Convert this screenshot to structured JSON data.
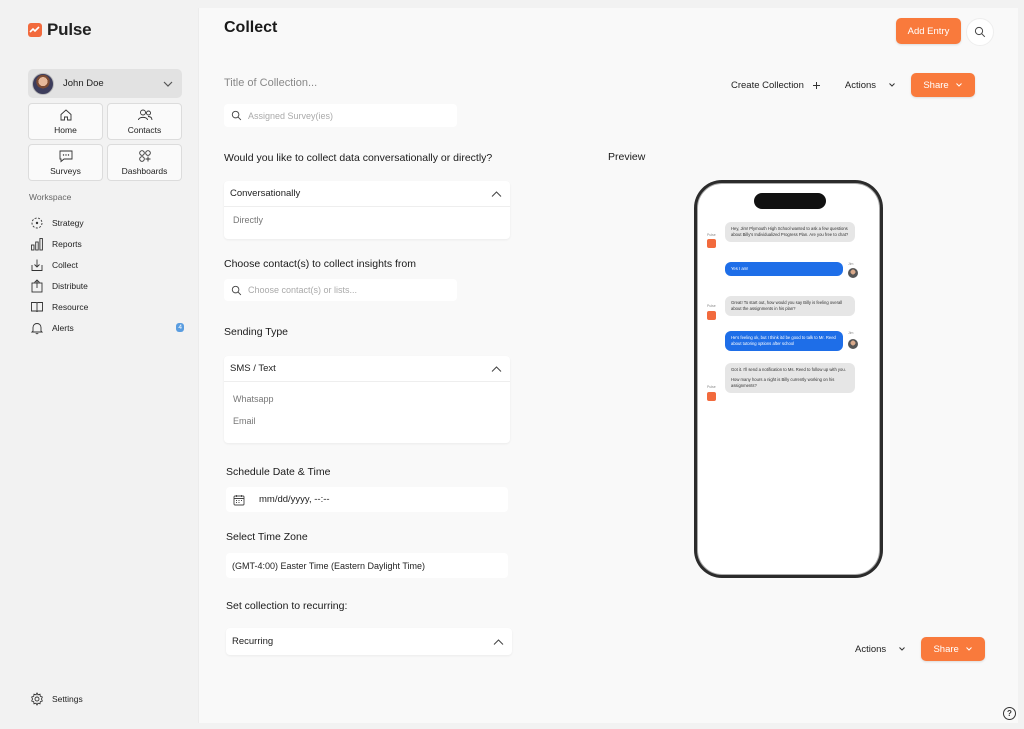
{
  "app": {
    "name": "Pulse",
    "brand_color": "#f26a3d"
  },
  "user": {
    "name": "John Doe"
  },
  "nav_tiles": [
    {
      "label": "Home",
      "icon": "home-icon"
    },
    {
      "label": "Contacts",
      "icon": "contacts-icon"
    },
    {
      "label": "Surveys",
      "icon": "chat-icon"
    },
    {
      "label": "Dashboards",
      "icon": "dashboard-icon"
    }
  ],
  "workspace": {
    "label": "Workspace",
    "items": [
      {
        "label": "Strategy",
        "icon": "strategy-icon"
      },
      {
        "label": "Reports",
        "icon": "reports-icon"
      },
      {
        "label": "Collect",
        "icon": "collect-icon"
      },
      {
        "label": "Distribute",
        "icon": "distribute-icon"
      },
      {
        "label": "Resource",
        "icon": "book-icon"
      },
      {
        "label": "Alerts",
        "icon": "bell-icon",
        "badge": "4"
      }
    ]
  },
  "settings_label": "Settings",
  "header": {
    "title": "Collect",
    "add_entry": "Add Entry"
  },
  "form": {
    "title_placeholder": "Title of Collection...",
    "survey_placeholder": "Assigned Survey(ies)",
    "collect_question": "Would you like to collect data conversationally or directly?",
    "collect_selected": "Conversationally",
    "collect_options": [
      "Directly"
    ],
    "contacts_question": "Choose contact(s) to collect insights from",
    "contacts_placeholder": "Choose contact(s) or lists...",
    "sending_label": "Sending Type",
    "sending_selected": "SMS / Text",
    "sending_options": [
      "Whatsapp",
      "Email"
    ],
    "schedule_label": "Schedule Date & Time",
    "schedule_value": "mm/dd/yyyy, --:--",
    "timezone_label": "Select Time Zone",
    "timezone_value": "(GMT-4:00) Easter Time (Eastern Daylight Time)",
    "recurring_label": "Set collection to recurring:",
    "recurring_selected": "Recurring"
  },
  "toolbar": {
    "create_collection": "Create Collection",
    "actions": "Actions",
    "share": "Share"
  },
  "preview": {
    "label": "Preview",
    "messages": [
      {
        "from": "bot",
        "sender": "Pulse",
        "text": "Hey, Jim! Plymouth High School wanted to ask a few questions about Billy's Individualized Progress Plan. Are you free to chat?"
      },
      {
        "from": "me",
        "sender": "Jim",
        "text": "Yes I am!"
      },
      {
        "from": "bot",
        "sender": "Pulse",
        "text": "Great! To start out, how would you say Billy is feeling overall about the assignments in his plan?"
      },
      {
        "from": "me",
        "sender": "Jim",
        "text": "He's feeling ok, but I think itd be good to talk to Mr. Reed about tutoring options after school"
      },
      {
        "from": "bot",
        "sender": "Pulse",
        "text": "Got it. I'll send a notification to Ms. Reed to follow up with you."
      },
      {
        "from": "bot",
        "sender": "Pulse",
        "text": "How many hours a night is Billy currently working on his assignments?"
      }
    ]
  }
}
